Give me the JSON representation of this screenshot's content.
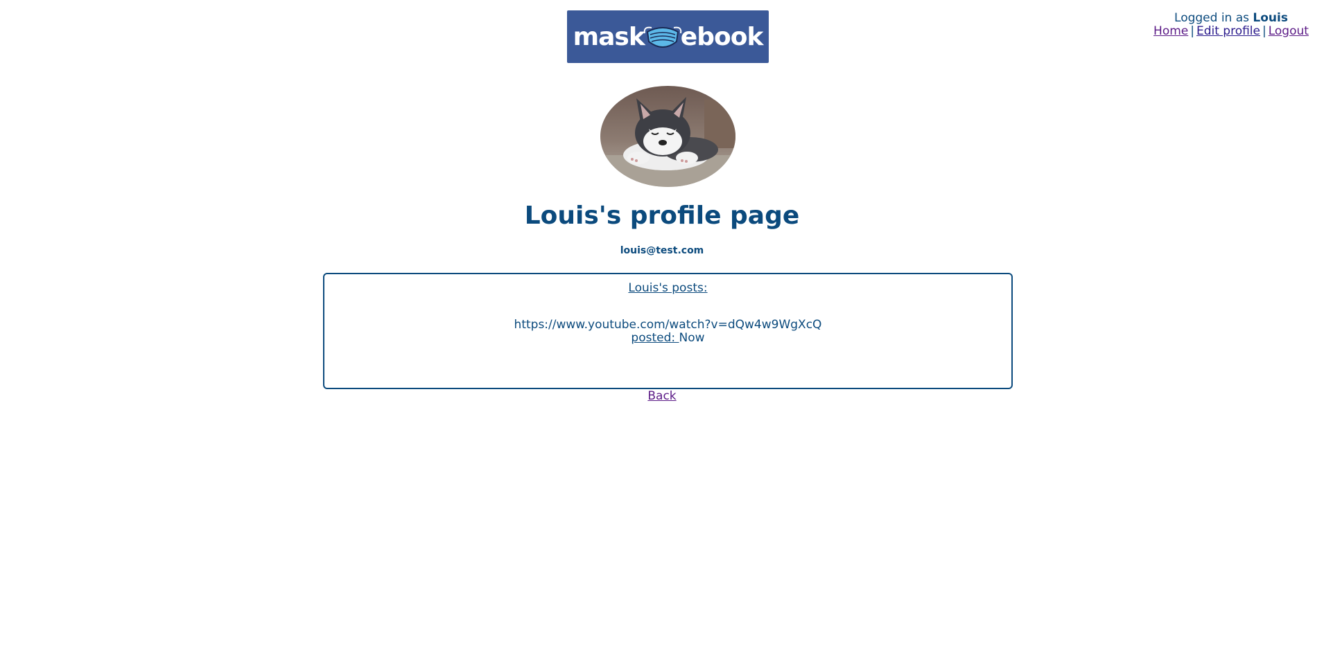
{
  "logo": {
    "text_left": "mask",
    "text_right": "ebook",
    "brand_color": "#3b5998"
  },
  "user_panel": {
    "logged_in_prefix": "Logged in as ",
    "username": "Louis",
    "links": [
      {
        "label": "Home"
      },
      {
        "label": "Edit profile"
      },
      {
        "label": "Logout"
      }
    ],
    "separator": "|"
  },
  "profile": {
    "title": "Louis's profile page",
    "email": "louis@test.com"
  },
  "posts": {
    "heading": "Louis's posts:",
    "items": [
      {
        "content": "https://www.youtube.com/watch?v=dQw4w9WgXcQ",
        "posted_label": "posted: ",
        "posted_value": "Now"
      }
    ]
  },
  "back_label": "Back",
  "colors": {
    "text": "#0b4a7d",
    "link": "#2a1a8c",
    "visited_link": "#5b1a86"
  }
}
